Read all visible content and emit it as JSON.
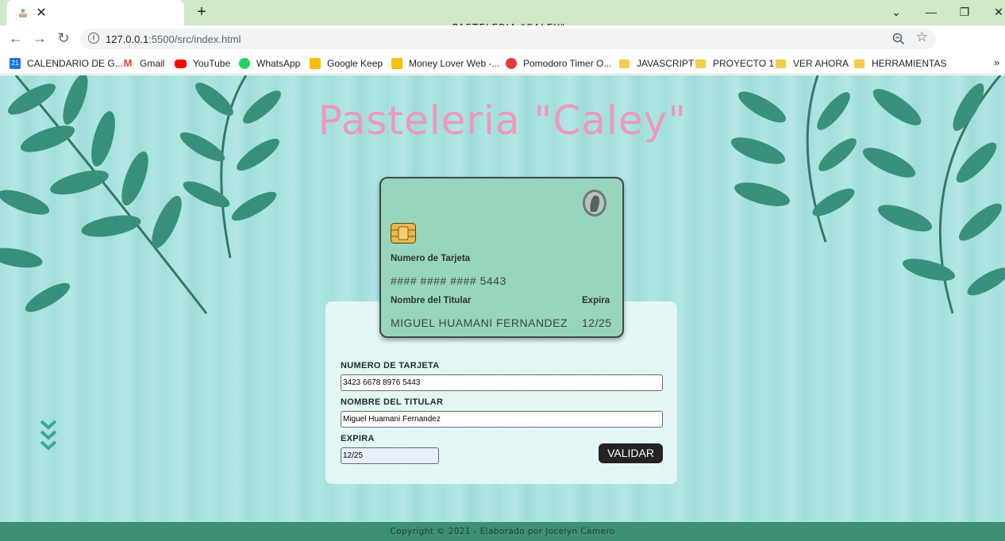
{
  "browser": {
    "tab": {
      "title": "PASTELERIA \"CALEY\""
    },
    "address": {
      "host": "127.0.0.1",
      "rest": ":5500/src/index.html"
    },
    "bookmarks": [
      {
        "label": "CALENDARIO DE G...",
        "color": "#1a73e8"
      },
      {
        "label": "Gmail",
        "color": "#ea4335"
      },
      {
        "label": "YouTube",
        "color": "#ff0000"
      },
      {
        "label": "WhatsApp",
        "color": "#25d366"
      },
      {
        "label": "Google Keep",
        "color": "#fbbc04"
      },
      {
        "label": "Money Lover Web -...",
        "color": "#f4c20d"
      },
      {
        "label": "Pomodoro Timer O...",
        "color": "#e53935"
      },
      {
        "label": "JAVASCRIPT",
        "color": "#f7cb4d"
      },
      {
        "label": "PROYECTO 1",
        "color": "#f7cb4d"
      },
      {
        "label": "VER AHORA",
        "color": "#f7cb4d"
      },
      {
        "label": "HERRAMIENTAS",
        "color": "#f7cb4d"
      }
    ],
    "bookmarks_more": "»"
  },
  "page": {
    "title": "Pasteleria \"Caley\"",
    "card": {
      "number_label": "Numero de Tarjeta",
      "number_value": "#### #### #### 5443",
      "holder_label": "Nombre del Titular",
      "holder_value": "MIGUEL HUAMANI FERNANDEZ",
      "expiry_label": "Expira",
      "expiry_value": "12/25"
    },
    "form": {
      "number_label": "NUMERO DE TARJETA",
      "number_value": "3423 6678 8976 5443",
      "holder_label": "NOMBRE DEL TITULAR",
      "holder_value": "Miguel Huamani Fernandez",
      "expiry_label": "EXPIRA",
      "expiry_value": "12/25",
      "submit_label": "VALIDAR"
    },
    "footer": "Copyright © 2021 - Elaborado por Jocelyn Camero"
  },
  "colors": {
    "title": "#ef98be",
    "card": "#97d5bc",
    "footer": "#3f8f77",
    "background": "#a6e1df",
    "leaf": "#2f8a72"
  }
}
